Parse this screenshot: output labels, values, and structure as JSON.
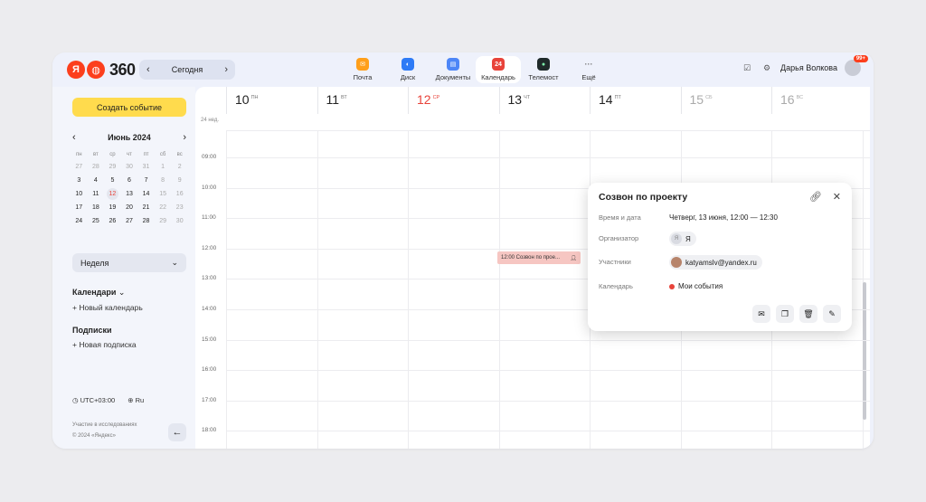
{
  "header": {
    "logo_letter": "Я",
    "logo_text": "360",
    "today_label": "Сегодня",
    "apps": [
      {
        "name": "Почта",
        "color": "#ff9f1a",
        "icon": "mail-icon"
      },
      {
        "name": "Диск",
        "color": "#2e7bf6",
        "icon": "disk-icon"
      },
      {
        "name": "Документы",
        "color": "#4d86f7",
        "icon": "documents-icon"
      },
      {
        "name": "Календарь",
        "color": "#e8433a",
        "icon": "calendar-icon",
        "badge": "24"
      },
      {
        "name": "Телемост",
        "color": "#1f2a2a",
        "icon": "telemost-icon"
      },
      {
        "name": "Ещё",
        "color": "#ffffff",
        "icon": "more-icon"
      }
    ],
    "user_name": "Дарья Волкова",
    "notif_badge": "99+"
  },
  "sidebar": {
    "create_button": "Создать событие",
    "month_title": "Июнь 2024",
    "weekdays": [
      "пн",
      "вт",
      "ср",
      "чт",
      "пт",
      "сб",
      "вс"
    ],
    "days": [
      [
        "27",
        "28",
        "29",
        "30",
        "31",
        "1",
        "2"
      ],
      [
        "3",
        "4",
        "5",
        "6",
        "7",
        "8",
        "9"
      ],
      [
        "10",
        "11",
        "12",
        "13",
        "14",
        "15",
        "16"
      ],
      [
        "17",
        "18",
        "19",
        "20",
        "21",
        "22",
        "23"
      ],
      [
        "24",
        "25",
        "26",
        "27",
        "28",
        "29",
        "30"
      ]
    ],
    "view_select": "Неделя",
    "calendars_title": "Календари",
    "new_calendar": "Новый календарь",
    "subscriptions_title": "Подписки",
    "new_subscription": "Новая подписка",
    "timezone": "UTC+03:00",
    "language": "Ru",
    "research_link": "Участие в исследованиях",
    "copyright": "© 2024 «Яндекс»"
  },
  "calendar": {
    "week_label": "24 нед.",
    "days": [
      {
        "num": "10",
        "wd": "ПН"
      },
      {
        "num": "11",
        "wd": "ВТ"
      },
      {
        "num": "12",
        "wd": "СР"
      },
      {
        "num": "13",
        "wd": "ЧТ"
      },
      {
        "num": "14",
        "wd": "ПТ"
      },
      {
        "num": "15",
        "wd": "СБ"
      },
      {
        "num": "16",
        "wd": "ВС"
      }
    ],
    "hours": [
      "09:00",
      "10:00",
      "11:00",
      "12:00",
      "13:00",
      "14:00",
      "15:00",
      "16:00",
      "17:00",
      "18:00"
    ],
    "event_label": "12:00 Созвон по прое..."
  },
  "popup": {
    "title": "Созвон по проекту",
    "time_label": "Время и дата",
    "time_value": "Четверг, 13 июня, 12:00 — 12:30",
    "organizer_label": "Организатор",
    "organizer_initial": "Я",
    "organizer_value": "Я",
    "participants_label": "Участники",
    "participant_value": "katyamslv@yandex.ru",
    "calendar_label": "Календарь",
    "calendar_value": "Мои события"
  }
}
